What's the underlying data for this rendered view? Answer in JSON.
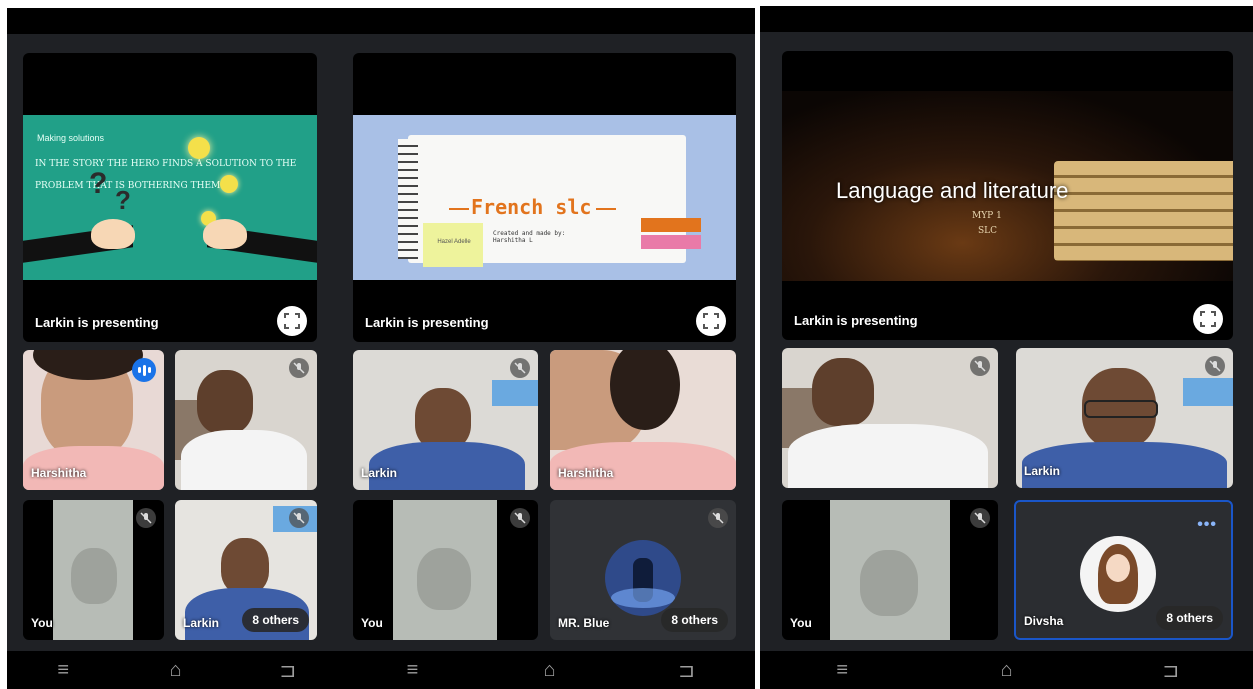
{
  "screens": [
    {
      "presenting_label": "Larkin is presenting",
      "slide": {
        "heading": "Making solutions",
        "line1": "IN THE STORY THE HERO FINDS A SOLUTION TO THE",
        "line2": "PROBLEM THAT IS BOTHERING THEM"
      },
      "tiles": [
        {
          "name": "Harshitha",
          "status": "speaking"
        },
        {
          "name": "",
          "status": "muted"
        },
        {
          "name": "You",
          "status": "muted"
        },
        {
          "name": "Larkin",
          "status": "muted",
          "others": "8 others"
        }
      ]
    },
    {
      "presenting_label": "Larkin is presenting",
      "slide": {
        "title": "French slc",
        "sticky_note": "Hazel Adelle",
        "credit": "Created and made by: Harshitha L"
      },
      "tiles": [
        {
          "name": "Larkin",
          "status": "muted"
        },
        {
          "name": "Harshitha",
          "status": "none"
        },
        {
          "name": "You",
          "status": "muted"
        },
        {
          "name": "MR. Blue",
          "status": "muted",
          "others": "8 others"
        }
      ]
    },
    {
      "presenting_label": "Larkin is presenting",
      "slide": {
        "title": "Language and literature",
        "subtitle1": "MYP 1",
        "subtitle2": "SLC"
      },
      "tiles": [
        {
          "name": "",
          "status": "muted"
        },
        {
          "name": "Larkin",
          "status": "muted"
        },
        {
          "name": "You",
          "status": "muted"
        },
        {
          "name": "Divsha",
          "status": "more",
          "others": "8 others"
        }
      ]
    }
  ],
  "nav": {
    "menu": "≡",
    "home": "⌂",
    "back": "⊐"
  },
  "colors": {
    "teal_slide": "#21a088",
    "blue_slide": "#a9c0e6",
    "speaking": "#1a73e8",
    "tile_bg": "#2d2f33"
  }
}
